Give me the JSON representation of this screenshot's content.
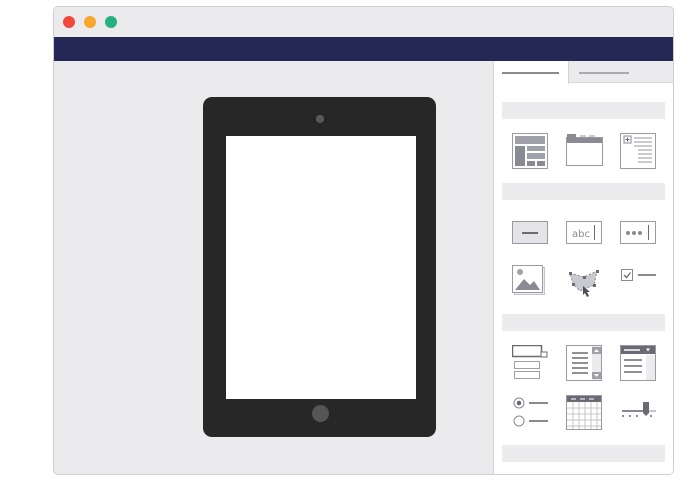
{
  "window": {
    "traffic_lights": {
      "close_color": "#f0493a",
      "minimize_color": "#f9a62c",
      "zoom_color": "#26b080"
    },
    "toolbar_color": "#252854"
  },
  "canvas": {
    "device": "tablet"
  },
  "panel": {
    "tabs": [
      {
        "label": "",
        "active": true
      },
      {
        "label": "",
        "active": false
      }
    ],
    "sections": [
      {
        "title": "",
        "widgets": [
          "layout-grid-icon",
          "browser-window-icon",
          "tree-list-icon"
        ]
      },
      {
        "title": "",
        "widgets": [
          "button-icon",
          "text-input-icon",
          "password-input-icon",
          "image-icon",
          "hotspot-icon",
          "checkbox-icon"
        ]
      },
      {
        "title": "",
        "widgets": [
          "combobox-icon",
          "scrolling-list-icon",
          "dropdown-list-icon",
          "radio-group-icon",
          "calendar-icon",
          "slider-icon"
        ]
      },
      {
        "title": "",
        "widgets": []
      }
    ]
  }
}
